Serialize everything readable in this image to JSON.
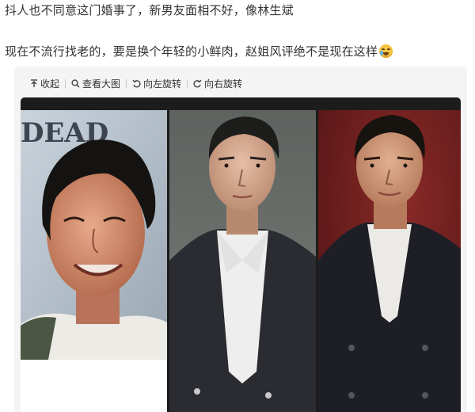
{
  "post": {
    "line1": "抖人也不同意这门婚事了，新男友面相不好，像林生斌",
    "line2": "现在不流行找老的，要是换个年轻的小鲜肉，赵姐风评绝不是现在这样",
    "emoji": "laugh-cry-emoji"
  },
  "toolbar": {
    "collapse_label": "收起",
    "view_large_label": "查看大图",
    "rotate_left_label": "向左旋转",
    "rotate_right_label": "向右旋转",
    "icons": [
      "arrow-up-icon",
      "magnifier-icon",
      "rotate-left-icon",
      "rotate-right-icon"
    ]
  },
  "photos": {
    "items": [
      {
        "name": "photo-left-smiling-man",
        "background_text": "DEAD"
      },
      {
        "name": "photo-middle-man-dark-jacket"
      },
      {
        "name": "photo-right-man-dark-suit"
      }
    ]
  },
  "colors": {
    "text": "#333333",
    "toolbar_bg": "#f4f4f4",
    "photo_frame": "#1c1c1c",
    "right_photo_bg": "#7a1c1c"
  }
}
